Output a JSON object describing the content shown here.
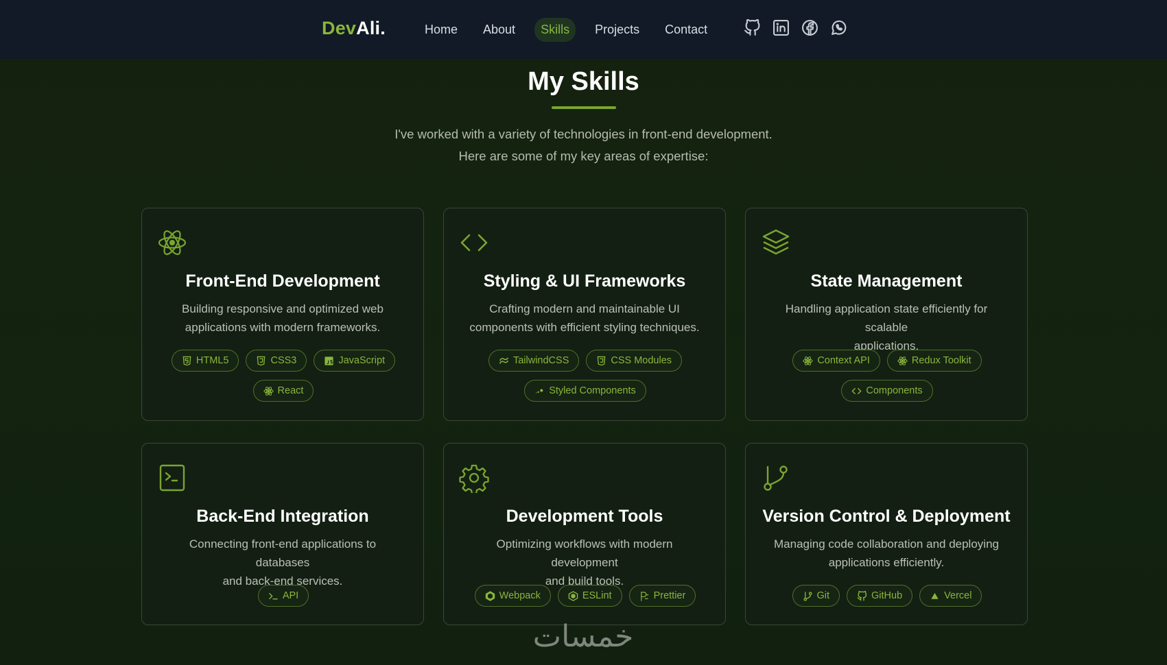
{
  "navbar": {
    "logo_dev": "Dev",
    "logo_ali": "Ali.",
    "links": [
      {
        "label": "Home"
      },
      {
        "label": "About"
      },
      {
        "label": "Skills"
      },
      {
        "label": "Projects"
      },
      {
        "label": "Contact"
      }
    ],
    "active_link": "Skills",
    "socials": [
      "github-icon",
      "linkedin-icon",
      "facebook-icon",
      "whatsapp-icon"
    ]
  },
  "header": {
    "title": "My Skills",
    "subtitle_line1": "I've worked with a variety of technologies in front-end development.",
    "subtitle_line2": "Here are some of my key areas of expertise:"
  },
  "cards": [
    {
      "icon": "react-icon",
      "title": "Front-End Development",
      "desc_line1": "Building responsive and optimized web",
      "desc_line2": "applications with modern frameworks.",
      "tags": [
        {
          "icon": "html5-icon",
          "label": "HTML5"
        },
        {
          "icon": "css3-icon",
          "label": "CSS3"
        },
        {
          "icon": "javascript-icon",
          "label": "JavaScript"
        },
        {
          "icon": "react-icon",
          "label": "React"
        }
      ]
    },
    {
      "icon": "code-icon",
      "title": "Styling & UI Frameworks",
      "desc_line1": "Crafting modern and maintainable UI",
      "desc_line2": "components with efficient styling techniques.",
      "tags": [
        {
          "icon": "tailwind-icon",
          "label": "TailwindCSS"
        },
        {
          "icon": "css3-icon",
          "label": "CSS Modules"
        },
        {
          "icon": "styled-components-icon",
          "label": "Styled Components"
        }
      ]
    },
    {
      "icon": "layers-icon",
      "title": "State Management",
      "desc_line1": "Handling application state efficiently for scalable",
      "desc_line2": "applications.",
      "tags": [
        {
          "icon": "react-icon",
          "label": "Context API"
        },
        {
          "icon": "react-icon",
          "label": "Redux Toolkit"
        },
        {
          "icon": "code-icon",
          "label": "Components"
        }
      ]
    },
    {
      "icon": "terminal-icon",
      "title": "Back-End Integration",
      "desc_line1": "Connecting front-end applications to databases",
      "desc_line2": "and back-end services.",
      "tags": [
        {
          "icon": "terminal-icon",
          "label": "API"
        }
      ]
    },
    {
      "icon": "gear-icon",
      "title": "Development Tools",
      "desc_line1": "Optimizing workflows with modern development",
      "desc_line2": "and build tools.",
      "tags": [
        {
          "icon": "webpack-icon",
          "label": "Webpack"
        },
        {
          "icon": "eslint-icon",
          "label": "ESLint"
        },
        {
          "icon": "prettier-icon",
          "label": "Prettier"
        }
      ]
    },
    {
      "icon": "git-branch-icon",
      "title": "Version Control & Deployment",
      "desc_line1": "Managing code collaboration and deploying",
      "desc_line2": "applications efficiently.",
      "tags": [
        {
          "icon": "git-icon",
          "label": "Git"
        },
        {
          "icon": "github-icon",
          "label": "GitHub"
        },
        {
          "icon": "vercel-icon",
          "label": "Vercel"
        }
      ]
    }
  ],
  "watermark": "خمسات",
  "colors": {
    "accent": "#8ab63a",
    "nav_bg": "#111a26",
    "page_bg": "#132310",
    "card_border": "#3a463a"
  }
}
